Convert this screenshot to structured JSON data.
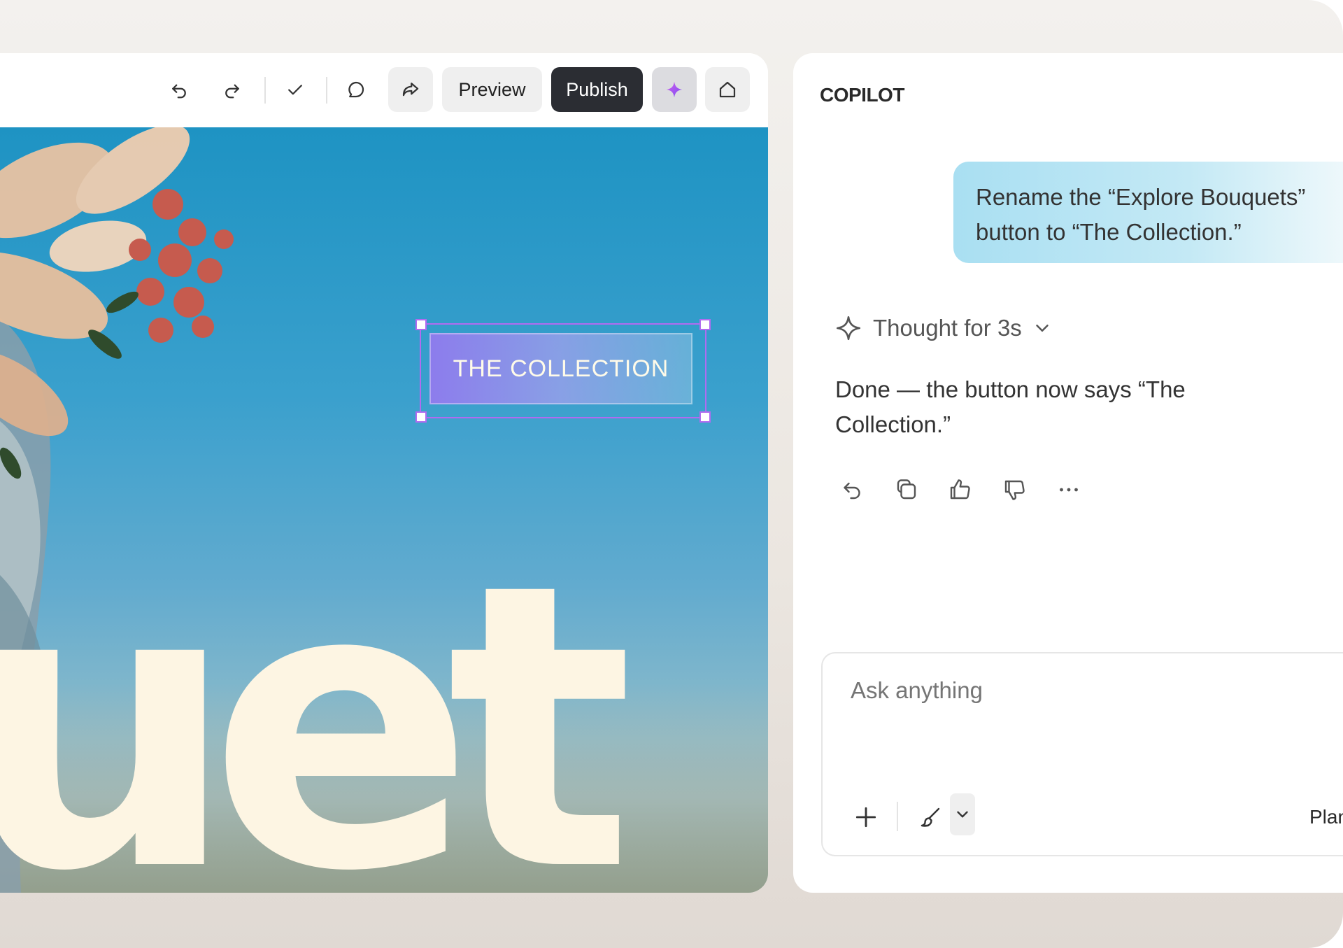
{
  "toolbar": {
    "preview_label": "Preview",
    "publish_label": "Publish",
    "icons": [
      "undo-icon",
      "redo-icon",
      "check-icon",
      "comment-icon",
      "share-icon",
      "sparkle-icon",
      "home-icon"
    ],
    "accent_color": "#b16bf0"
  },
  "canvas": {
    "hero_text": "uet",
    "cta_button_label": "THE COLLECTION"
  },
  "copilot": {
    "title": "COPILOT",
    "user_message": "Rename the “Explore Bouquets” button to “The Collection.”",
    "thought_label": "Thought for 3s",
    "answer": "Done — the button now says “The Collection.”",
    "composer": {
      "placeholder": "Ask anything",
      "mode_label": "Plan"
    }
  }
}
